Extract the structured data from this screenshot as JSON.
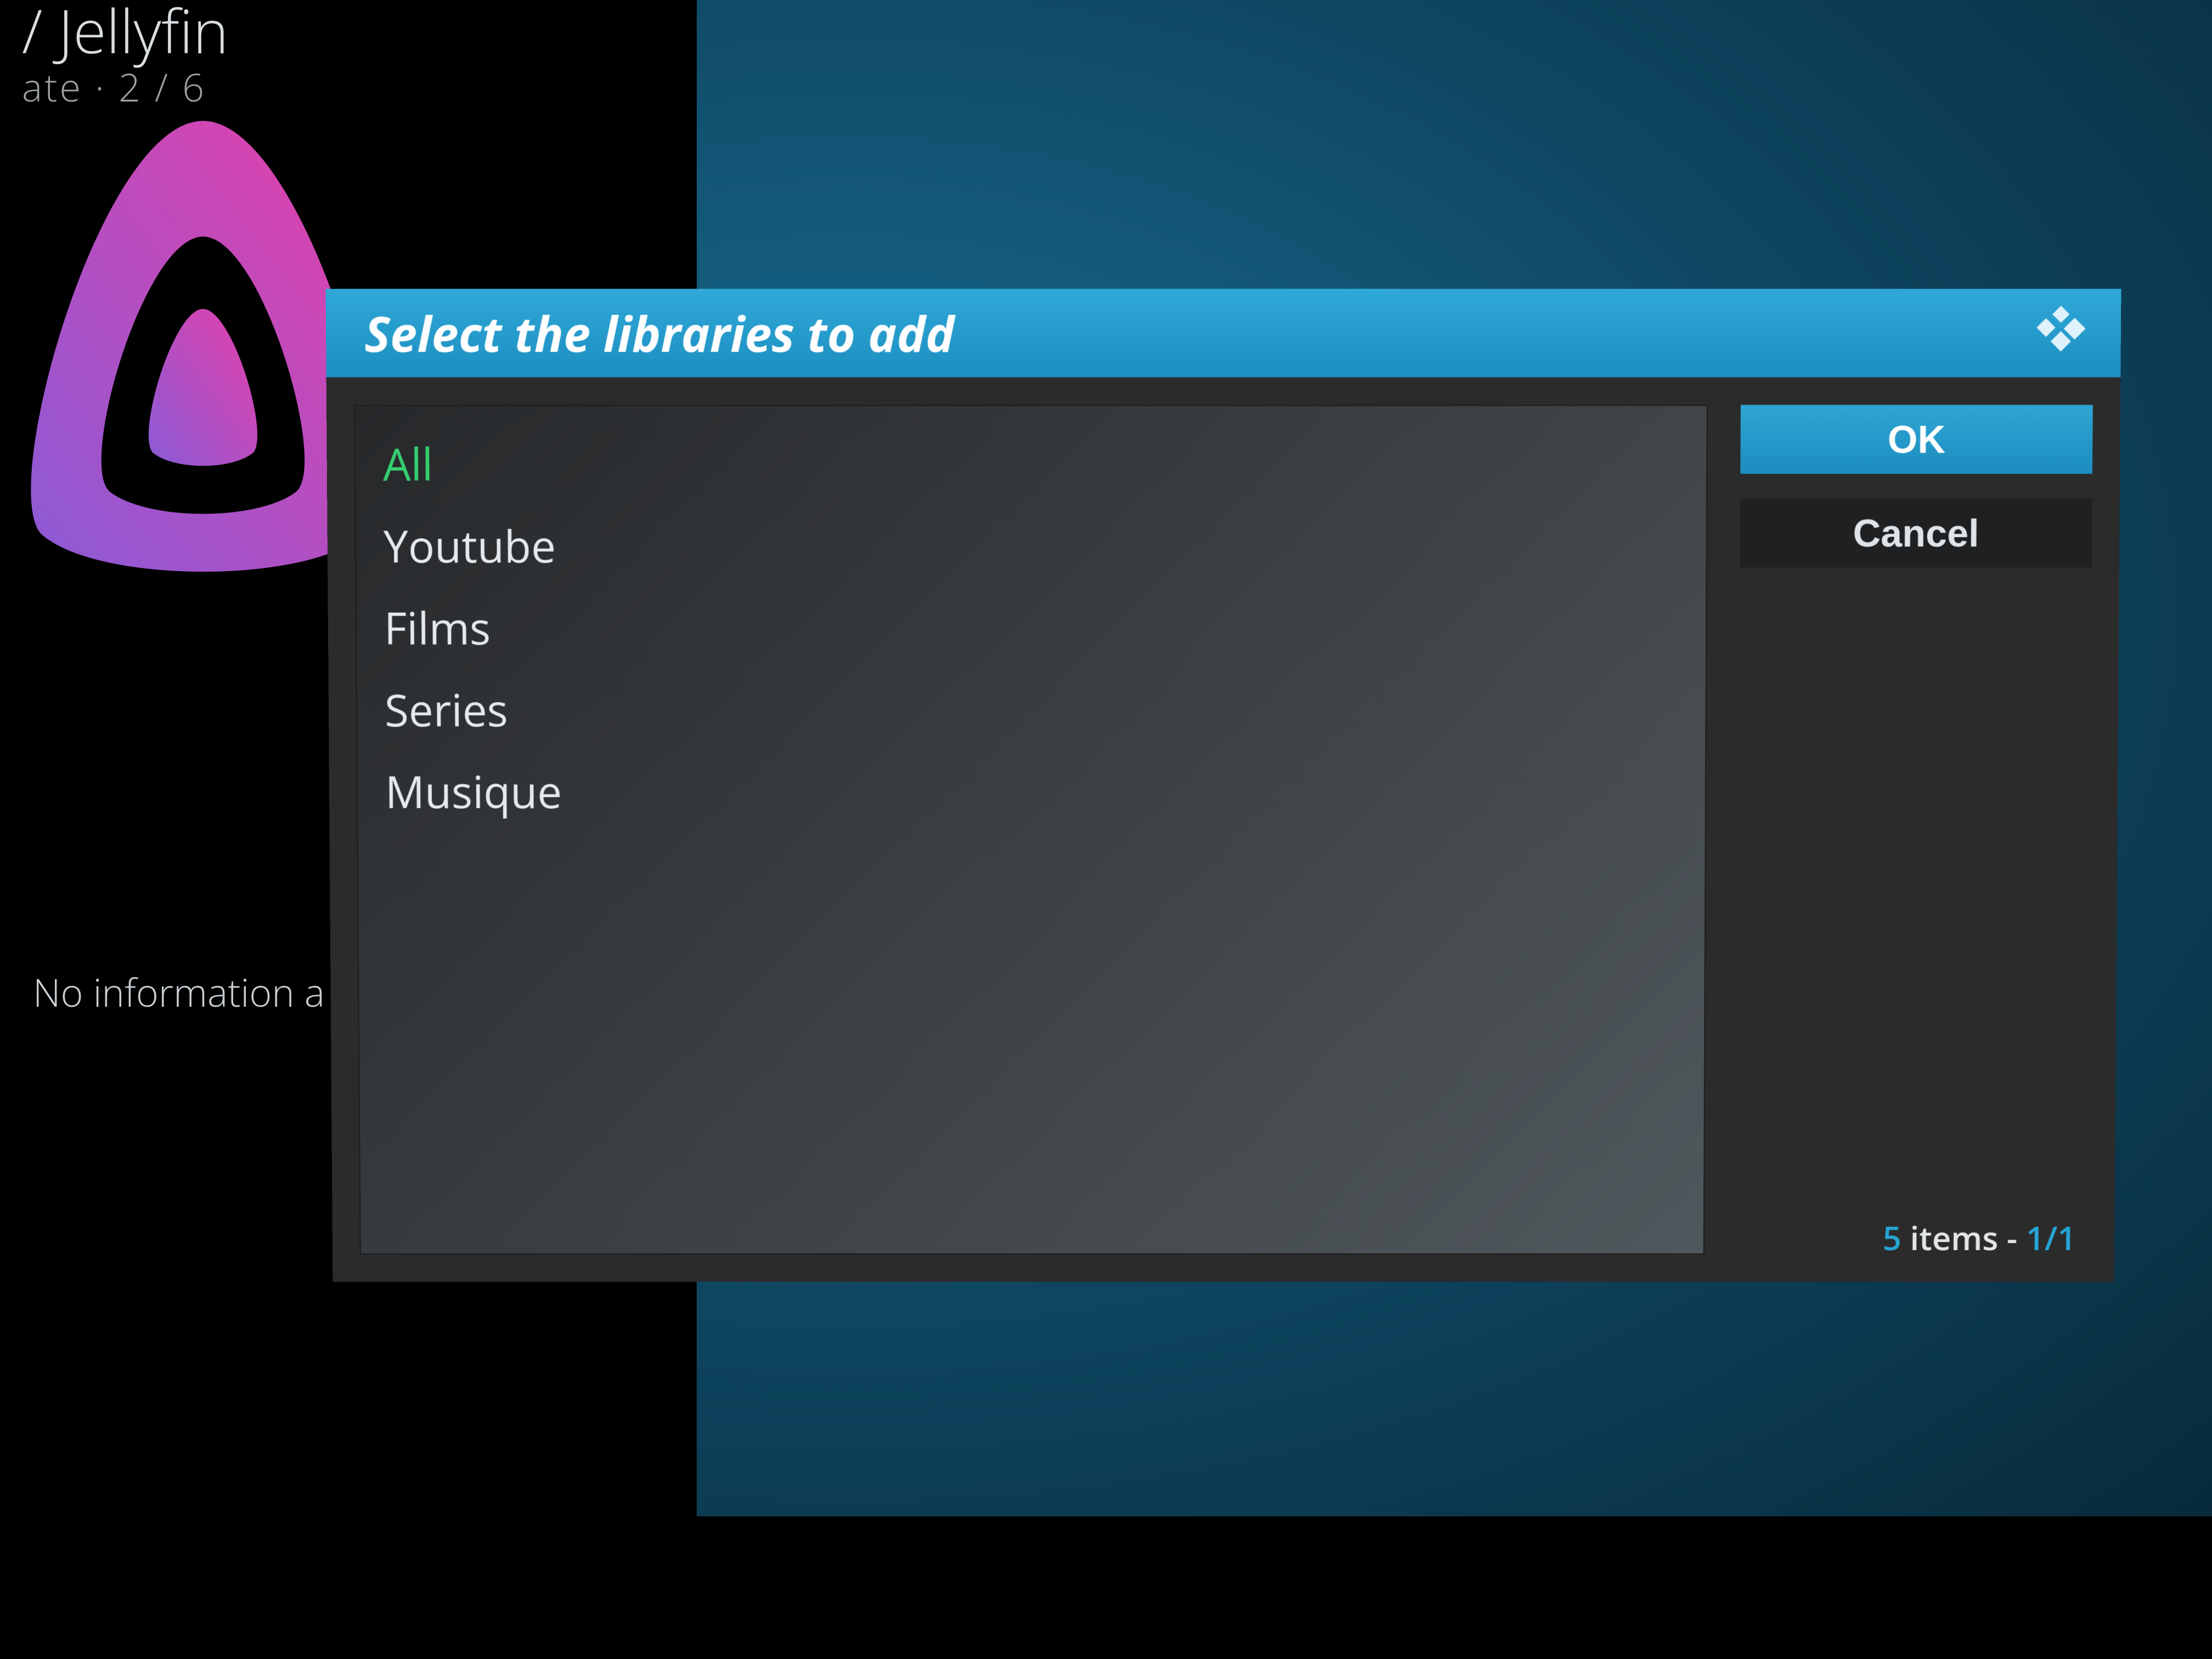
{
  "background": {
    "title_suffix": "/ Jellyfin",
    "subline": "ate  ·  2 / 6",
    "info_text": "No information a"
  },
  "dialog": {
    "title": "Select the libraries to add",
    "list_items": [
      {
        "label": "All",
        "selected": true
      },
      {
        "label": "Youtube",
        "selected": false
      },
      {
        "label": "Films",
        "selected": false
      },
      {
        "label": "Series",
        "selected": false
      },
      {
        "label": "Musique",
        "selected": false
      }
    ],
    "buttons": {
      "ok": "OK",
      "cancel": "Cancel"
    },
    "footer": {
      "count": "5",
      "items_word": " items - ",
      "page": "1/1"
    }
  }
}
